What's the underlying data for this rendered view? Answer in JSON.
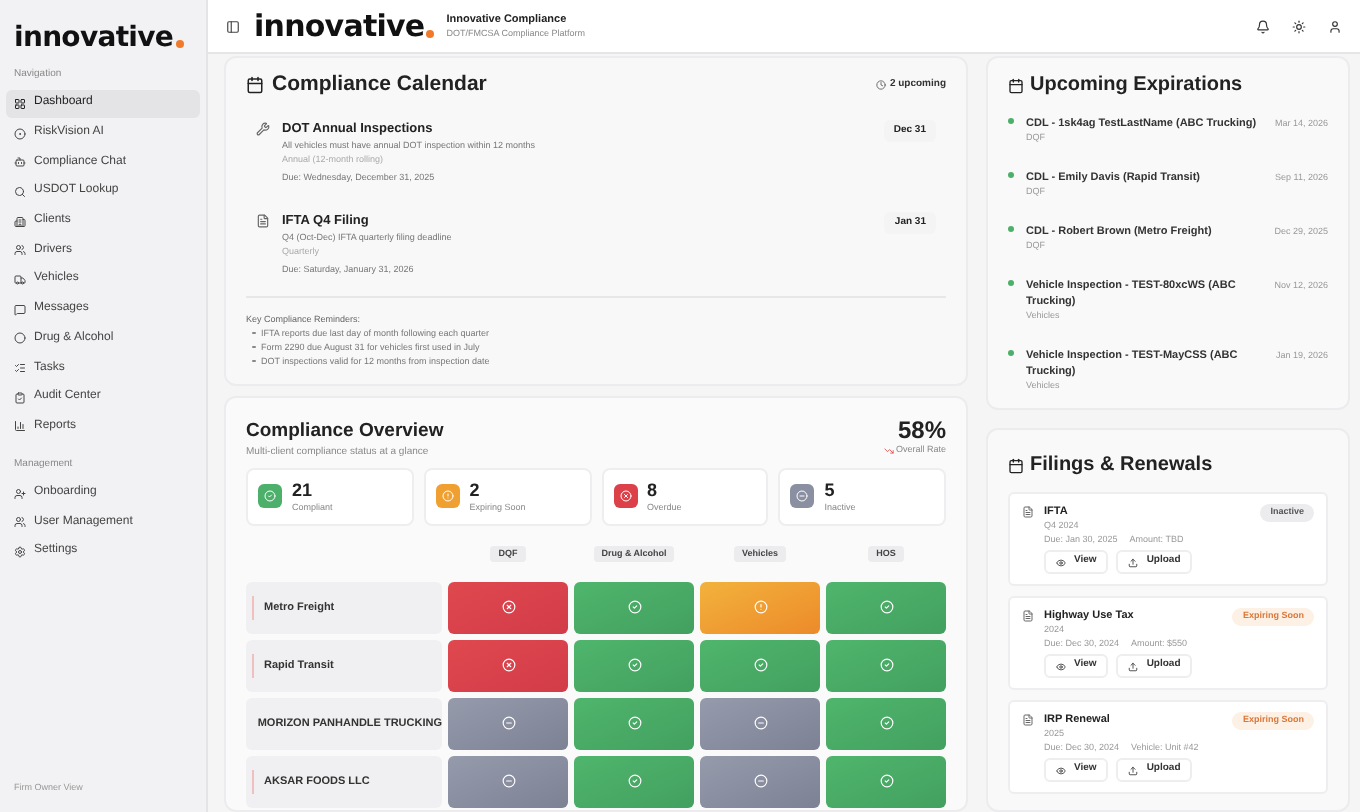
{
  "sidebar": {
    "logo": "innovative",
    "sections": [
      {
        "title": "Navigation",
        "items": [
          {
            "label": "Dashboard",
            "selected": true
          },
          {
            "label": "RiskVision AI",
            "selected": false
          },
          {
            "label": "Compliance Chat",
            "selected": false
          },
          {
            "label": "USDOT Lookup",
            "selected": false
          },
          {
            "label": "Clients",
            "selected": false
          },
          {
            "label": "Drivers",
            "selected": false
          },
          {
            "label": "Vehicles",
            "selected": false
          },
          {
            "label": "Messages",
            "selected": false
          },
          {
            "label": "Drug & Alcohol",
            "selected": false
          },
          {
            "label": "Tasks",
            "selected": false
          },
          {
            "label": "Audit Center",
            "selected": false
          },
          {
            "label": "Reports",
            "selected": false
          }
        ]
      },
      {
        "title": "Management",
        "items": [
          {
            "label": "Onboarding",
            "selected": false
          },
          {
            "label": "User Management",
            "selected": false
          },
          {
            "label": "Settings",
            "selected": false
          }
        ]
      }
    ],
    "footer": "Firm Owner View"
  },
  "header": {
    "logo": "innovative",
    "title": "Innovative Compliance",
    "subtitle": "DOT/FMCSA Compliance Platform"
  },
  "calendar": {
    "title": "Compliance Calendar",
    "badge": "2 upcoming",
    "items": [
      {
        "kind": "inspection",
        "title": "DOT Annual Inspections",
        "description": "All vehicles must have annual DOT inspection within 12 months",
        "frequency": "Annual (12-month rolling)",
        "due": "Due: Wednesday, December 31, 2025",
        "date": "Dec 31"
      },
      {
        "kind": "filing",
        "title": "IFTA Q4 Filing",
        "description": "Q4 (Oct-Dec) IFTA quarterly filing deadline",
        "frequency": "Quarterly",
        "due": "Due: Saturday, January 31, 2026",
        "date": "Jan 31"
      }
    ],
    "reminders_title": "Key Compliance Reminders:",
    "reminders": [
      "IFTA reports due last day of month following each quarter",
      "Form 2290 due August 31 for vehicles first used in July",
      "DOT inspections valid for 12 months from inspection date"
    ]
  },
  "overview": {
    "title": "Compliance Overview",
    "subtitle": "Multi-client compliance status at a glance",
    "rate": "58%",
    "rate_label": "Overall Rate",
    "stats": [
      {
        "value": "21",
        "label": "Compliant",
        "kind": "ok",
        "color": "#4caf6a"
      },
      {
        "value": "2",
        "label": "Expiring Soon",
        "kind": "warn",
        "color": "#f0a030"
      },
      {
        "value": "8",
        "label": "Overdue",
        "kind": "fail",
        "color": "#dc4048"
      },
      {
        "value": "5",
        "label": "Inactive",
        "kind": "inactive",
        "color": "#8a90a2"
      }
    ],
    "columns": [
      "DQF",
      "Drug & Alcohol",
      "Vehicles",
      "HOS"
    ],
    "rows": [
      {
        "name": "Metro Freight",
        "accent": true,
        "cells": [
          {
            "kind": "fail"
          },
          {
            "kind": "ok"
          },
          {
            "kind": "warn"
          },
          {
            "kind": "ok"
          }
        ]
      },
      {
        "name": "Rapid Transit",
        "accent": true,
        "cells": [
          {
            "kind": "fail"
          },
          {
            "kind": "ok"
          },
          {
            "kind": "ok"
          },
          {
            "kind": "ok"
          }
        ]
      },
      {
        "name": "MORIZON PANHANDLE TRUCKING",
        "accent": false,
        "cells": [
          {
            "kind": "inactive"
          },
          {
            "kind": "ok"
          },
          {
            "kind": "inactive"
          },
          {
            "kind": "ok"
          }
        ]
      },
      {
        "name": "AKSAR FOODS LLC",
        "accent": true,
        "cells": [
          {
            "kind": "inactive"
          },
          {
            "kind": "ok"
          },
          {
            "kind": "inactive"
          },
          {
            "kind": "ok"
          }
        ]
      }
    ]
  },
  "expirations": {
    "title": "Upcoming Expirations",
    "items": [
      {
        "title": "CDL - 1sk4ag TestLastName (ABC Trucking)",
        "category": "DQF",
        "date": "Mar 14, 2026",
        "color": "#4caf6a"
      },
      {
        "title": "CDL - Emily Davis (Rapid Transit)",
        "category": "DQF",
        "date": "Sep 11, 2026",
        "color": "#4caf6a"
      },
      {
        "title": "CDL - Robert Brown (Metro Freight)",
        "category": "DQF",
        "date": "Dec 29, 2025",
        "color": "#4caf6a"
      },
      {
        "title": "Vehicle Inspection - TEST-80xcWS (ABC Trucking)",
        "category": "Vehicles",
        "date": "Nov 12, 2026",
        "color": "#4caf6a"
      },
      {
        "title": "Vehicle Inspection - TEST-MayCSS (ABC Trucking)",
        "category": "Vehicles",
        "date": "Jan 19, 2026",
        "color": "#4caf6a"
      }
    ]
  },
  "filings": {
    "title": "Filings & Renewals",
    "items": [
      {
        "title": "IFTA",
        "period": "Q4 2024",
        "due": "Due: Jan 30, 2025",
        "extra": "Amount: TBD",
        "status": "Inactive",
        "kind": "inactive",
        "view": "View",
        "upload": "Upload"
      },
      {
        "title": "Highway Use Tax",
        "period": "2024",
        "due": "Due: Dec 30, 2024",
        "extra": "Amount: $550",
        "status": "Expiring Soon",
        "kind": "expiring",
        "view": "View",
        "upload": "Upload"
      },
      {
        "title": "IRP Renewal",
        "period": "2025",
        "due": "Due: Dec 30, 2024",
        "extra": "Vehicle: Unit #42",
        "status": "Expiring Soon",
        "kind": "expiring",
        "view": "View",
        "upload": "Upload"
      }
    ]
  }
}
